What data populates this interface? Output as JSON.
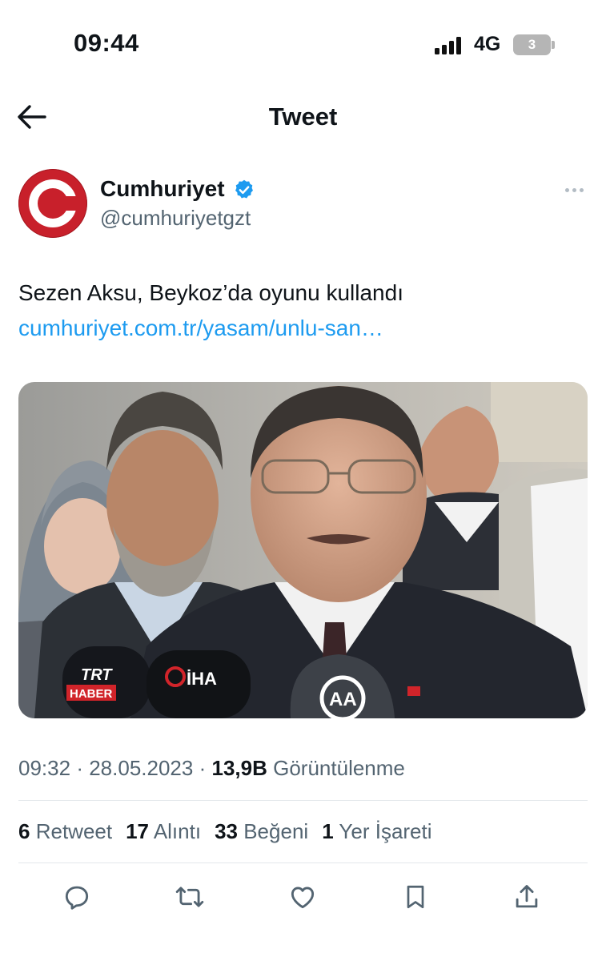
{
  "status_bar": {
    "time": "09:44",
    "network": "4G",
    "battery": "3"
  },
  "header": {
    "title": "Tweet",
    "back_icon": "arrow-left-icon"
  },
  "author": {
    "name": "Cumhuriyet",
    "handle": "@cumhuriyetgzt",
    "verified": true,
    "brand_color": "#c8202b",
    "verified_color": "#1d9bf0"
  },
  "tweet": {
    "text": "Sezen Aksu, Beykoz’da oyunu kullandı",
    "link": "cumhuriyet.com.tr/yasam/unlu-san…",
    "media_alt": "TRT HABER",
    "media_mic_labels": [
      "TRT",
      "HABER",
      "İHA",
      "AA"
    ]
  },
  "meta": {
    "time": "09:32",
    "date": "28.05.2023",
    "views_count": "13,9B",
    "views_label": "Görüntülenme",
    "separator": "·"
  },
  "stats": [
    {
      "count": "6",
      "label": "Retweet"
    },
    {
      "count": "17",
      "label": "Alıntı"
    },
    {
      "count": "33",
      "label": "Beğeni"
    },
    {
      "count": "1",
      "label": "Yer İşareti"
    }
  ],
  "actions": [
    "reply-icon",
    "retweet-icon",
    "like-icon",
    "bookmark-icon",
    "share-icon"
  ]
}
